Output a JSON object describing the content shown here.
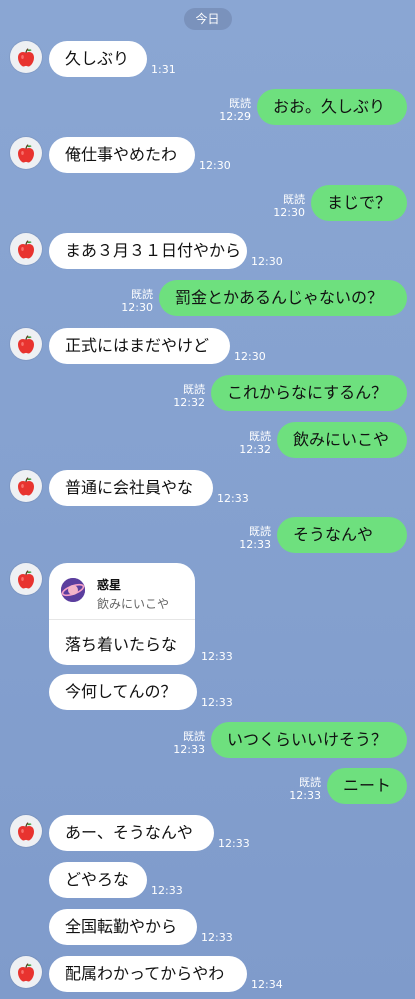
{
  "date_label": "今日",
  "read_label": "既読",
  "colors": {
    "bg": "#86a2d0",
    "out_bubble": "#6ee07e",
    "in_bubble": "#ffffff"
  },
  "messages": [
    {
      "side": "in",
      "text": "久しぶり",
      "time": "1:31"
    },
    {
      "side": "out",
      "text": "おお。久しぶり",
      "time": "12:29",
      "read": true
    },
    {
      "side": "in",
      "text": "俺仕事やめたわ",
      "time": "12:30"
    },
    {
      "side": "out",
      "text": "まじで？",
      "time": "12:30",
      "read": true
    },
    {
      "side": "in",
      "text": "まあ３月３１日付やから",
      "time": "12:30"
    },
    {
      "side": "out",
      "text": "罰金とかあるんじゃないの？",
      "time": "12:30",
      "read": true
    },
    {
      "side": "in",
      "text": "正式にはまだやけど",
      "time": "12:30"
    },
    {
      "side": "out",
      "text": "これからなにするん？",
      "time": "12:32",
      "read": true
    },
    {
      "side": "out",
      "text": "飲みにいこや",
      "time": "12:32",
      "read": true
    },
    {
      "side": "in",
      "text": "普通に会社員やな",
      "time": "12:33"
    },
    {
      "side": "out",
      "text": "そうなんや",
      "time": "12:33",
      "read": true
    },
    {
      "side": "in",
      "type": "reply",
      "reply_title": "惑星",
      "reply_quote": "飲みにいこや",
      "text": "落ち着いたらな",
      "time": "12:33"
    },
    {
      "side": "in",
      "text": "今何してんの？",
      "time": "12:33"
    },
    {
      "side": "out",
      "text": "いつくらいいけそう？",
      "time": "12:33",
      "read": true
    },
    {
      "side": "out",
      "text": "ニート",
      "time": "12:33",
      "read": true
    },
    {
      "side": "in",
      "text": "あー、そうなんや",
      "time": "12:33"
    },
    {
      "side": "in",
      "text": "どやろな",
      "time": "12:33"
    },
    {
      "side": "in",
      "text": "全国転勤やから",
      "time": "12:33"
    },
    {
      "side": "in",
      "text": "配属わかってからやわ",
      "time": "12:34"
    }
  ]
}
